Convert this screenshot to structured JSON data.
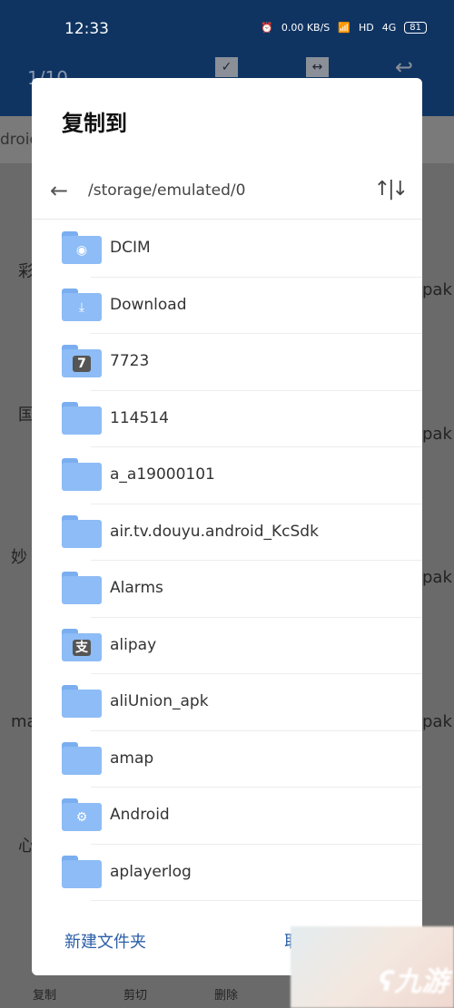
{
  "status_bar": {
    "time": "12:33",
    "net_speed": "0.00 KB/S",
    "hd": "HD",
    "signal": "4G",
    "battery": "81"
  },
  "background": {
    "page_counter": "1/10",
    "breadcrumb": "droid",
    "left_labels": [
      "彩",
      "国",
      "妙",
      "ma",
      "心"
    ],
    "right_labels": [
      "pak",
      "pak",
      "pak",
      "pak"
    ],
    "toolbar": [
      "复制",
      "剪切",
      "删除"
    ]
  },
  "dialog": {
    "title": "复制到",
    "path": "/storage/emulated/0",
    "folders": [
      {
        "name": "DCIM",
        "icon": "camera-icon"
      },
      {
        "name": "Download",
        "icon": "download-icon"
      },
      {
        "name": "7723",
        "icon": "app-7723-icon"
      },
      {
        "name": "114514",
        "icon": "folder-icon"
      },
      {
        "name": "a_a19000101",
        "icon": "folder-icon"
      },
      {
        "name": "air.tv.douyu.android_KcSdk",
        "icon": "folder-icon"
      },
      {
        "name": "Alarms",
        "icon": "folder-icon"
      },
      {
        "name": "alipay",
        "icon": "alipay-icon"
      },
      {
        "name": "aliUnion_apk",
        "icon": "folder-icon"
      },
      {
        "name": "amap",
        "icon": "folder-icon"
      },
      {
        "name": "Android",
        "icon": "gear-icon"
      },
      {
        "name": "aplayerlog",
        "icon": "folder-icon"
      }
    ],
    "new_folder": "新建文件夹",
    "cancel": "取消"
  },
  "watermark": "九游"
}
